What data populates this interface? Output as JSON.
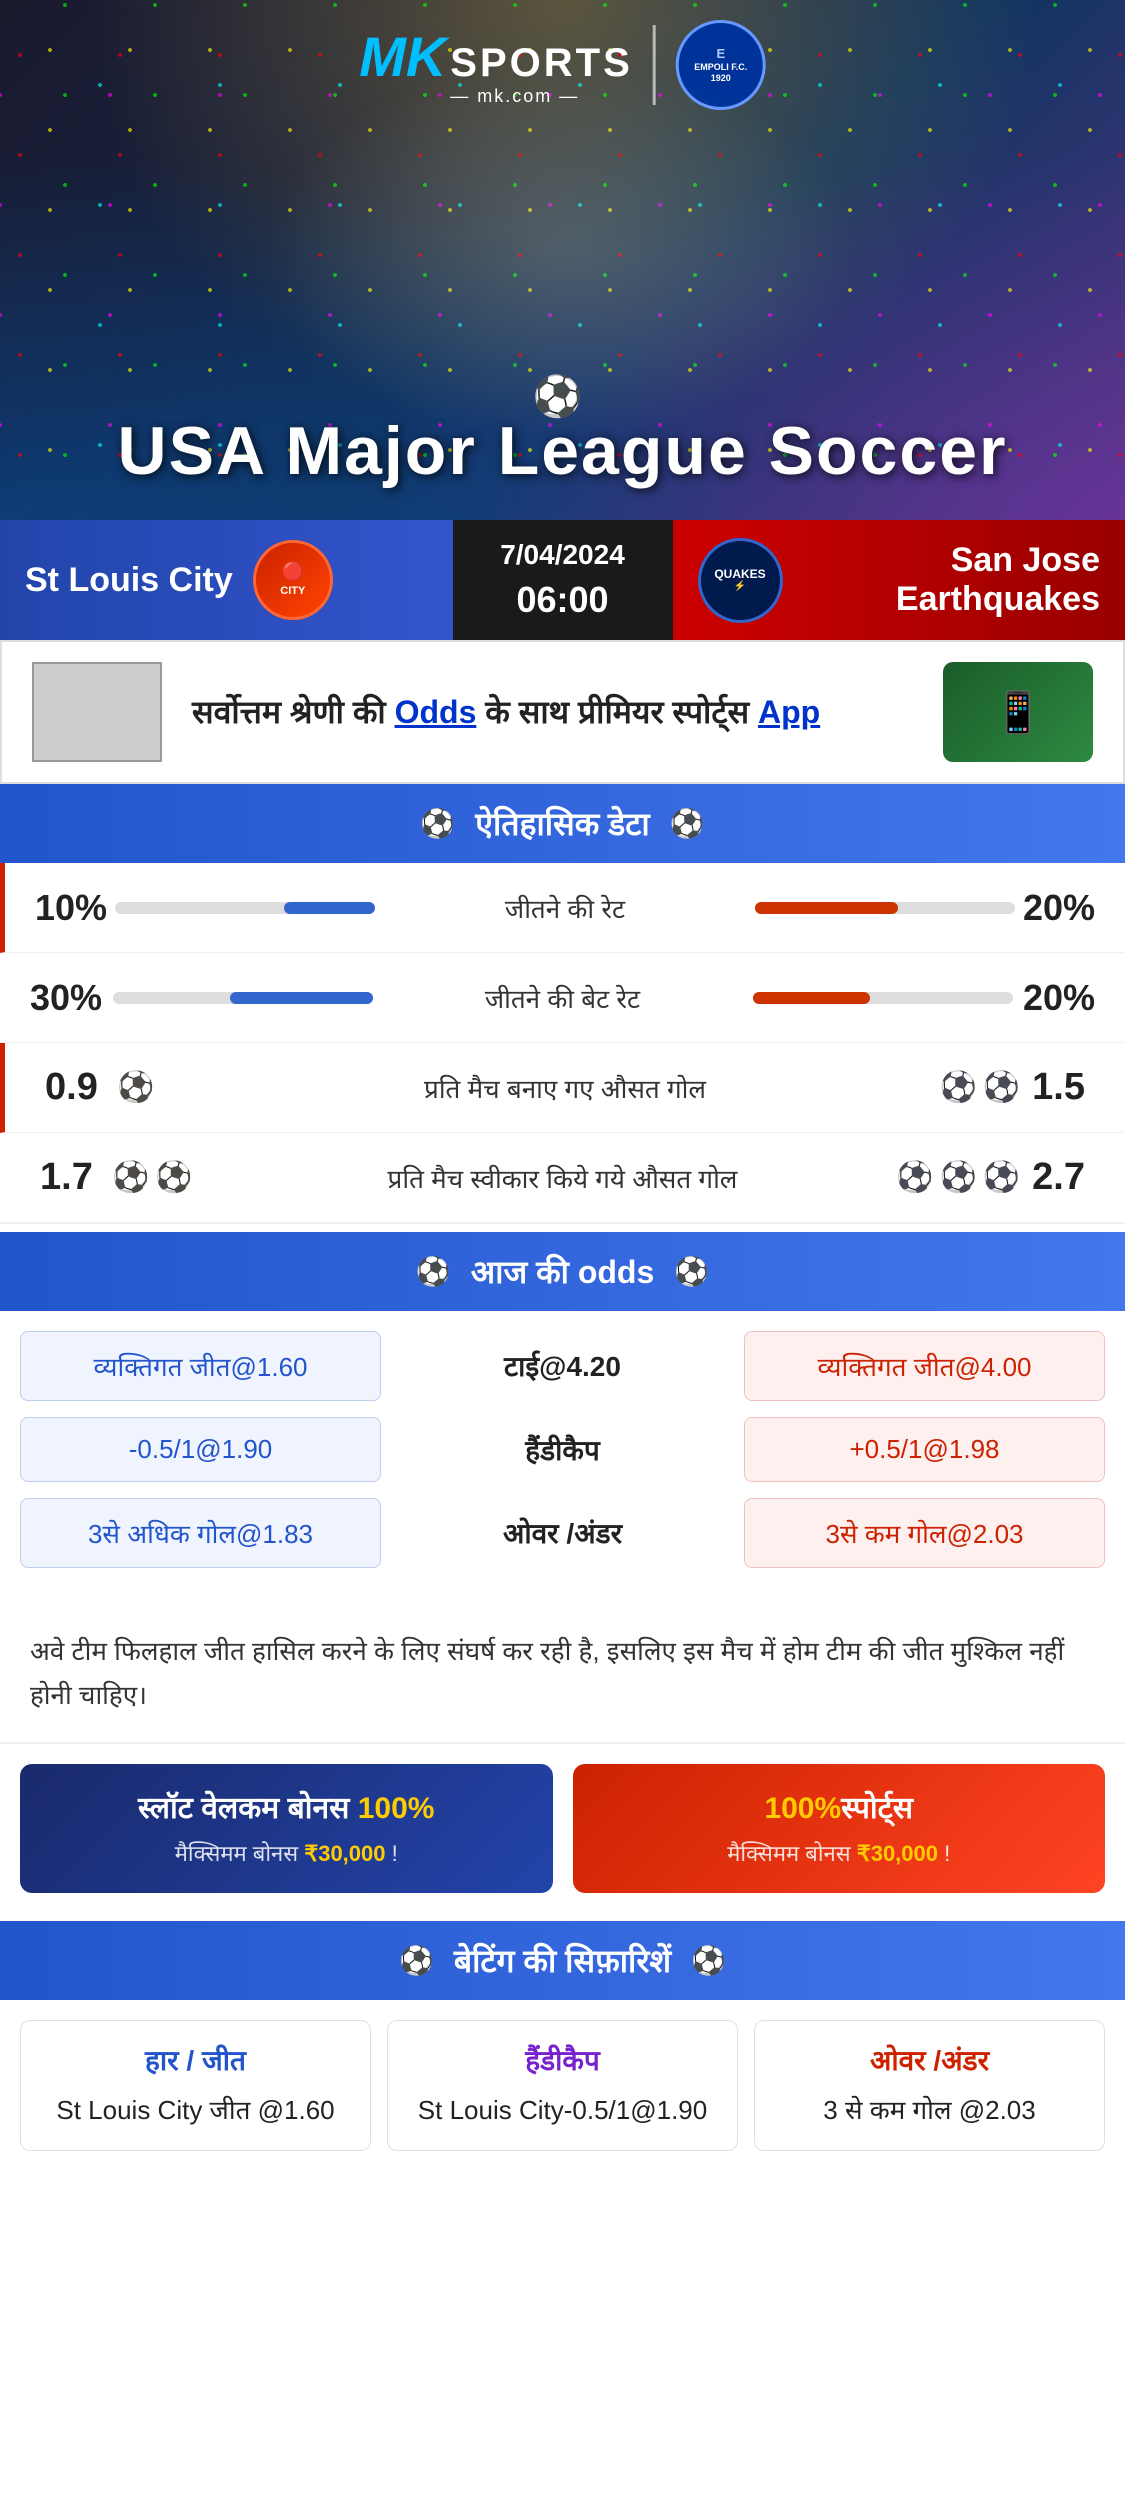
{
  "brand": {
    "mk_prefix": "MK",
    "sports_label": "SPORTS",
    "mk_com": "— mk.com —",
    "empoli_label": "EMPOLI F.C.\n1920"
  },
  "hero": {
    "title": "USA Major League Soccer"
  },
  "match": {
    "home_team": "St Louis City",
    "away_team": "San Jose Earthquakes",
    "date": "7/04/2024",
    "time": "06:00",
    "home_badge": "CITY",
    "away_badge": "QUAKES"
  },
  "promo": {
    "text_part1": "सर्वोत्तम श्रेणी की",
    "text_highlight": "Odds",
    "text_part2": "के साथ प्रीमियर स्पोर्ट्स",
    "text_app": "App"
  },
  "historical": {
    "section_title": "ऐतिहासिक डेटा",
    "stats": [
      {
        "label": "जीतने की रेट",
        "left_val": "10%",
        "right_val": "20%",
        "left_pct": 10,
        "right_pct": 20
      },
      {
        "label": "जीतने की बेट रेट",
        "left_val": "30%",
        "right_val": "20%",
        "left_pct": 30,
        "right_pct": 20
      }
    ],
    "goal_stats": [
      {
        "label": "प्रति मैच बनाए गए औसत गोल",
        "left_val": "0.9",
        "right_val": "1.5",
        "left_balls": 1,
        "right_balls": 2
      },
      {
        "label": "प्रति मैच स्वीकार किये गये औसत गोल",
        "left_val": "1.7",
        "right_val": "2.7",
        "left_balls": 2,
        "right_balls": 3
      }
    ]
  },
  "odds": {
    "section_title": "आज की odds",
    "rows": [
      {
        "left": "व्यक्तिगत जीत@1.60",
        "center": "टाई@4.20",
        "right": "व्यक्तिगत जीत@4.00"
      },
      {
        "left": "-0.5/1@1.90",
        "center": "हैंडीकैप",
        "right": "+0.5/1@1.98"
      },
      {
        "left": "3से अधिक गोल@1.83",
        "center": "ओवर /अंडर",
        "right": "3से कम गोल@2.03"
      }
    ]
  },
  "analysis": {
    "text": "अवे टीम फिलहाल जीत हासिल करने के लिए संघर्ष कर रही है, इसलिए इस मैच में होम टीम की जीत मुश्किल नहीं होनी चाहिए।"
  },
  "bonus": {
    "card1_title": "स्लॉट वेलकम बोनस 100%",
    "card1_sub": "मैक्सिमम बोनस ₹30,000  !",
    "card2_title": "100%स्पोर्ट्स",
    "card2_sub": "मैक्सिमम बोनस  ₹30,000 !"
  },
  "recommendations": {
    "section_title": "बेटिंग की सिफ़ारिशें",
    "cards": [
      {
        "header": "हार / जीत",
        "value": "St Louis City जीत @1.60",
        "color": "blue"
      },
      {
        "header": "हैंडीकैप",
        "value": "St Louis City-0.5/1@1.90",
        "color": "purple"
      },
      {
        "header": "ओवर /अंडर",
        "value": "3 से कम गोल @2.03",
        "color": "red"
      }
    ]
  }
}
